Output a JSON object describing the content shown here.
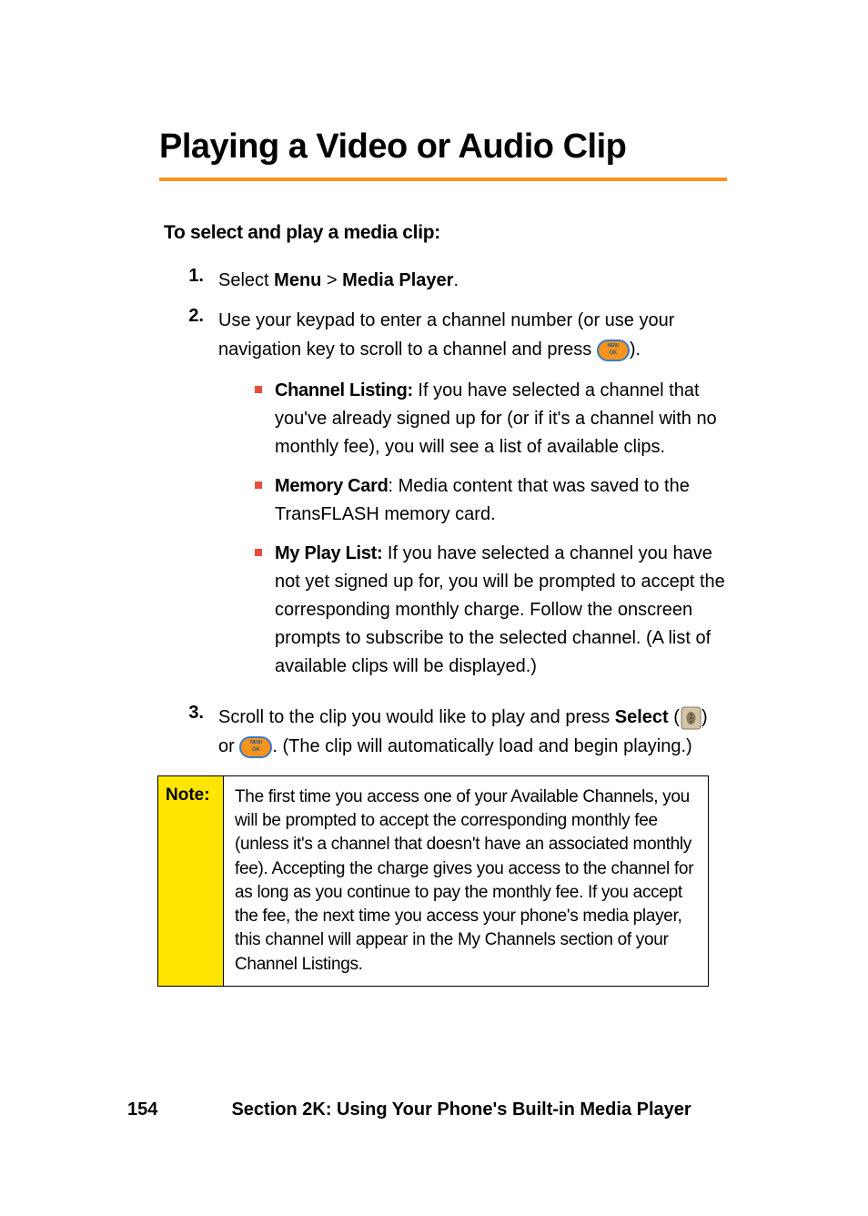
{
  "title": "Playing a Video or Audio Clip",
  "subheading": "To select and play a media clip:",
  "steps": [
    {
      "num": "1.",
      "prefix": "Select ",
      "bold1": "Menu",
      "mid": " > ",
      "bold2": "Media Player",
      "suffix": "."
    },
    {
      "num": "2.",
      "text1": "Use your keypad to enter a channel number (or use your navigation key to scroll to a channel and press ",
      "text2": ").",
      "bullets": [
        {
          "bold": "Channel Listing:",
          "text": " If you have selected a channel that you've already signed up for (or if it's a channel with no monthly fee), you will see a list of available clips."
        },
        {
          "bold": "Memory Card",
          "text": ": Media content that was saved to the TransFLASH memory card."
        },
        {
          "bold": "My Play List:",
          "text": " If you have selected a channel you have not yet signed up for, you will be prompted to accept the corresponding monthly charge. Follow the onscreen prompts to subscribe to the selected channel. (A list of available clips will be displayed.)"
        }
      ]
    },
    {
      "num": "3.",
      "text1": "Scroll to the clip you would like to play and press ",
      "bold1": "Select",
      "text2": " (",
      "text3": ") or ",
      "text4": ". (The clip will automatically load and begin playing.)"
    }
  ],
  "note": {
    "label": "Note:",
    "body": "The first time you access one of your Available Channels, you will be prompted to accept the corresponding monthly fee (unless it's a channel that doesn't have an associated monthly fee). Accepting the charge gives you access to the channel for as long as you continue to pay the monthly fee. If you accept the fee, the next time you access your phone's media player, this channel will appear in the My Channels section of your Channel Listings."
  },
  "footer": {
    "page": "154",
    "section": "Section 2K: Using Your Phone's Built-in Media Player"
  }
}
